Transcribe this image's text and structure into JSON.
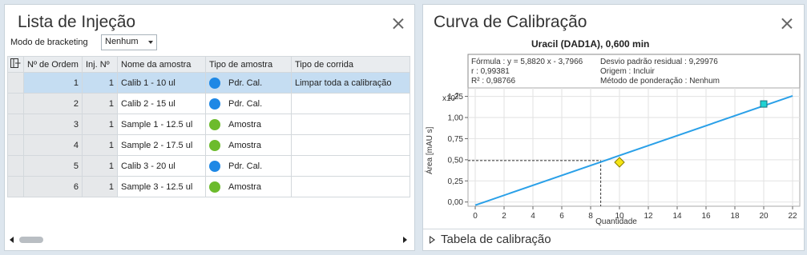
{
  "injection_list": {
    "title": "Lista de Injeção",
    "bracketing_label": "Modo de bracketing",
    "bracketing_value": "Nenhum",
    "columns": [
      "Nº de Ordem",
      "Inj. Nº",
      "Nome da amostra",
      "Tipo de amostra",
      "Tipo de corrida"
    ],
    "rows": [
      {
        "order": "1",
        "inj": "1",
        "name": "Calib 1 - 10 ul",
        "type": "Pdr. Cal.",
        "type_color": "#1e88e5",
        "run": "Limpar toda a calibração",
        "selected": true
      },
      {
        "order": "2",
        "inj": "1",
        "name": "Calib 2 - 15 ul",
        "type": "Pdr. Cal.",
        "type_color": "#1e88e5",
        "run": "",
        "selected": false
      },
      {
        "order": "3",
        "inj": "1",
        "name": "Sample 1 - 12.5 ul",
        "type": "Amostra",
        "type_color": "#6cbb2c",
        "run": "",
        "selected": false
      },
      {
        "order": "4",
        "inj": "1",
        "name": "Sample 2 - 17.5 ul",
        "type": "Amostra",
        "type_color": "#6cbb2c",
        "run": "",
        "selected": false
      },
      {
        "order": "5",
        "inj": "1",
        "name": "Calib 3 - 20 ul",
        "type": "Pdr. Cal.",
        "type_color": "#1e88e5",
        "run": "",
        "selected": false
      },
      {
        "order": "6",
        "inj": "1",
        "name": "Sample 3 - 12.5 ul",
        "type": "Amostra",
        "type_color": "#6cbb2c",
        "run": "",
        "selected": false
      }
    ]
  },
  "calibration": {
    "title": "Curva de Calibração",
    "footer_label": "Tabela de calibração",
    "info": {
      "formula": "Fórmula : y = 5,8820 x - 3,7966",
      "r": "r : 0,99381",
      "r2": "R² : 0,98766",
      "std_dev": "Desvio padrão residual : 9,29976",
      "origin": "Origem : Incluir",
      "weighting": "Método de ponderação : Nenhum"
    }
  },
  "chart_data": {
    "type": "line",
    "title": "Uracil (DAD1A), 0,600 min",
    "xlabel": "Quantidade",
    "ylabel": "Área [mAU s]",
    "y_multiplier_label": "x10",
    "y_multiplier_exp": "2",
    "xlim": [
      -0.5,
      22.5
    ],
    "ylim": [
      -0.05,
      1.35
    ],
    "x_ticks": [
      0,
      2,
      4,
      6,
      8,
      10,
      12,
      14,
      16,
      18,
      20,
      22
    ],
    "x_tick_labels": [
      "0",
      "2",
      "4",
      "6",
      "8",
      "10",
      "12",
      "14",
      "16",
      "18",
      "20",
      "22"
    ],
    "y_ticks": [
      0,
      0.25,
      0.5,
      0.75,
      1.0,
      1.25
    ],
    "y_tick_labels": [
      "0,00",
      "0,25",
      "0,50",
      "0,75",
      "1,00",
      "1,25"
    ],
    "fit_line": {
      "x": [
        0,
        22
      ],
      "y": [
        -0.038,
        1.256
      ]
    },
    "calibration_points": [
      {
        "x": 20,
        "y": 1.16
      }
    ],
    "sample_point": {
      "x": 10,
      "y": 0.47
    },
    "projection": {
      "x": 8.7,
      "y": 0.49
    },
    "colors": {
      "line": "#2aa0e8",
      "calibration_point": "#1fd2d2",
      "sample_point": "#f5e414"
    }
  }
}
